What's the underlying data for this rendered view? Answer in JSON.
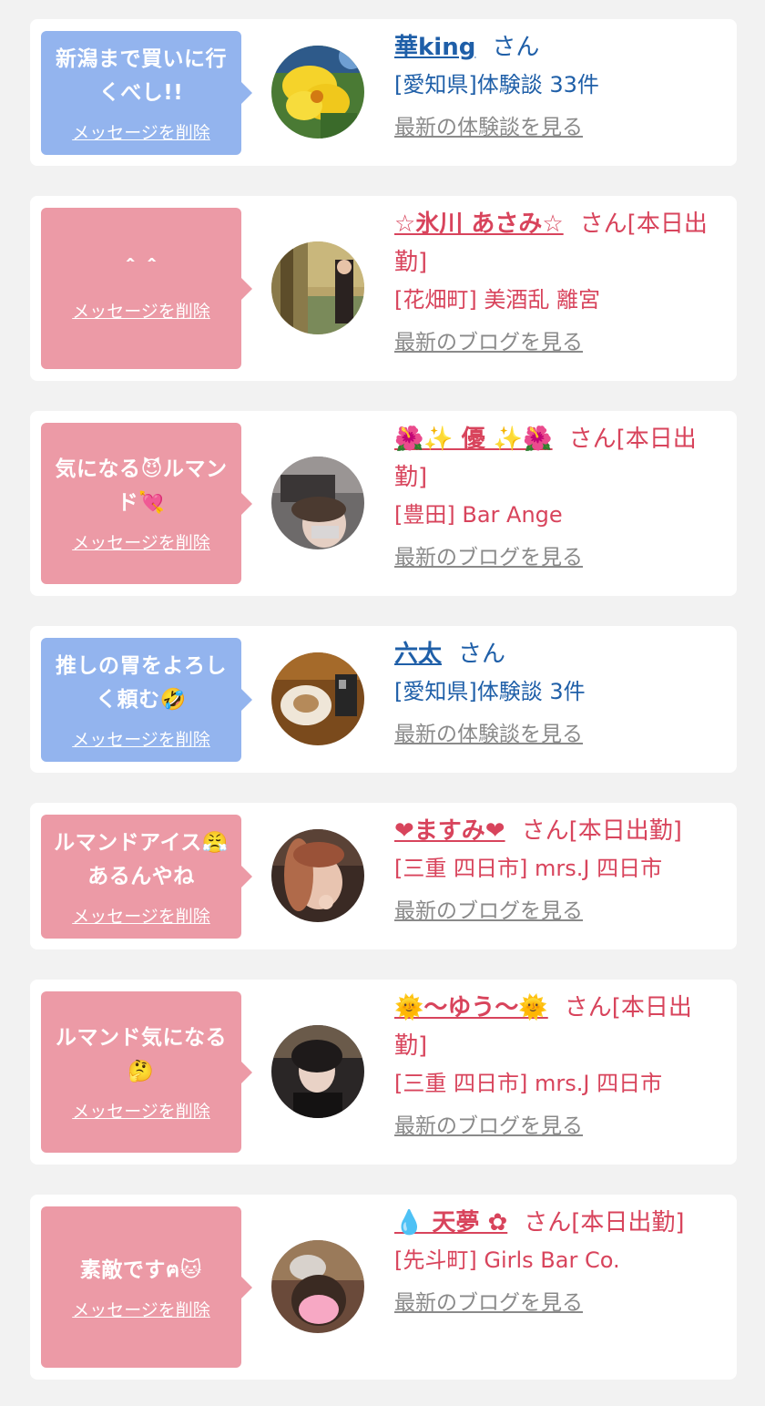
{
  "cards": [
    {
      "message": "新潟まで買いに行くべし!!",
      "delete_label": "メッセージを削除",
      "name": "華king",
      "suffix": "さん",
      "sub": "[愛知県]体験談 33件",
      "link": "最新の体験談を見る"
    },
    {
      "message": "＾＾",
      "delete_label": "メッセージを削除",
      "name": "☆氷川 あさみ☆",
      "suffix": "さん[本日出勤]",
      "sub": "[花畑町] 美酒乱 離宮",
      "link": "最新のブログを見る"
    },
    {
      "message": "気になる😈ルマンド💘",
      "delete_label": "メッセージを削除",
      "name": "🌺✨ 優 ✨🌺",
      "suffix": "さん[本日出勤]",
      "sub": "[豊田] Bar Ange",
      "link": "最新のブログを見る"
    },
    {
      "message": "推しの胃をよろしく頼む🤣",
      "delete_label": "メッセージを削除",
      "name": "六太",
      "suffix": "さん",
      "sub": "[愛知県]体験談 3件",
      "link": "最新の体験談を見る"
    },
    {
      "message": "ルマンドアイス😤あるんやね",
      "delete_label": "メッセージを削除",
      "name": "❤ますみ❤",
      "suffix": "さん[本日出勤]",
      "sub": "[三重 四日市] mrs.J 四日市",
      "link": "最新のブログを見る"
    },
    {
      "message": "ルマンド気になる🤔",
      "delete_label": "メッセージを削除",
      "name": "🌞〜ゆう〜🌞",
      "suffix": "さん[本日出勤]",
      "sub": "[三重 四日市] mrs.J 四日市",
      "link": "最新のブログを見る"
    },
    {
      "message": "素敵ですฅ🐱",
      "delete_label": "メッセージを削除",
      "name": "💧 天夢 ✿",
      "suffix": "さん[本日出勤]",
      "sub": "[先斗町] Girls Bar Co.",
      "link": "最新のブログを見る"
    }
  ],
  "colors": {
    "blue_bubble": "#93b4ee",
    "pink_bubble": "#ec9aa6",
    "blue_text": "#1f5fa8",
    "pink_text": "#d8445c",
    "link_gray": "#8a8a8a",
    "page_bg": "#f2f2f2"
  }
}
